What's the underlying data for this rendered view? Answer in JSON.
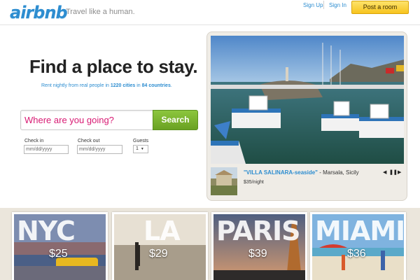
{
  "header": {
    "logo": "airbnb",
    "tagline": "Travel like a human.",
    "signup": "Sign Up",
    "signin": "Sign In",
    "post_room": "Post a room"
  },
  "hero": {
    "headline": "Find a place to stay.",
    "sub_prefix": "Rent nightly from real people in ",
    "sub_cities": "1220 cities",
    "sub_mid": " in ",
    "sub_countries": "84 countries",
    "sub_suffix": "."
  },
  "search": {
    "placeholder": "Where are you going?",
    "button": "Search",
    "checkin_label": "Check in",
    "checkin_placeholder": "mm/dd/yyyy",
    "checkout_label": "Check out",
    "checkout_placeholder": "mm/dd/yyyy",
    "guests_label": "Guests",
    "guests_value": "1"
  },
  "featured": {
    "title": "\"VILLA SALINARA-seaside\"",
    "location": " - Marsala, Sicily",
    "price": "$35/night",
    "prev_icon": "prev-arrow-icon",
    "pause_icon": "pause-icon",
    "next_icon": "next-arrow-icon"
  },
  "cities": [
    {
      "name": "NYC",
      "price": "$25"
    },
    {
      "name": "LA",
      "price": "$29"
    },
    {
      "name": "PARIS",
      "price": "$39"
    },
    {
      "name": "MIAMI",
      "price": "$36"
    }
  ],
  "colors": {
    "brand_blue": "#2d8dd0",
    "search_text": "#d81a73",
    "search_green": "#7bb52f",
    "post_yellow": "#f9d33b"
  }
}
